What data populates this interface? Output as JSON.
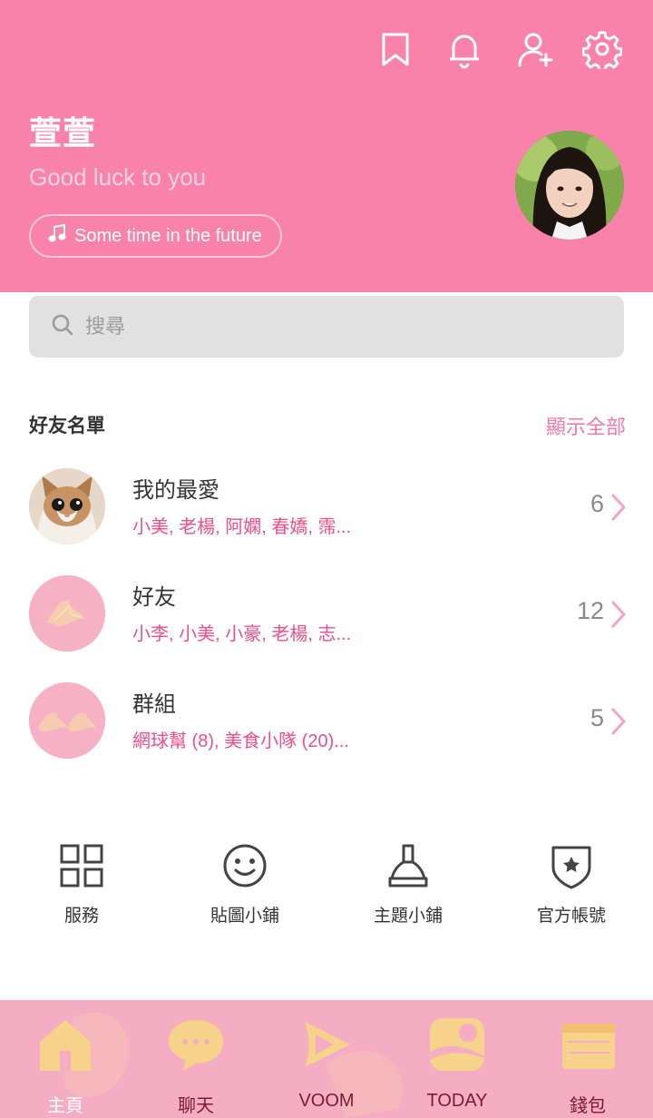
{
  "header": {
    "name": "萱萱",
    "status_message": "Good luck to you",
    "music": "Some time in the future",
    "icons": [
      "bookmark-icon",
      "bell-icon",
      "add-friend-icon",
      "gear-icon"
    ],
    "bg_color": "#f882aa"
  },
  "search": {
    "placeholder": "搜尋"
  },
  "friends": {
    "title": "好友名單",
    "show_all": "顯示全部",
    "rows": [
      {
        "title": "我的最愛",
        "members": "小美, 老楊, 阿嫻, 春嬌, 霈...",
        "count": "6"
      },
      {
        "title": "好友",
        "members": "小李, 小美, 小豪, 老楊, 志...",
        "count": "12"
      },
      {
        "title": "群組",
        "members": "網球幫 (8), 美食小隊 (20)...",
        "count": "5"
      }
    ]
  },
  "services": [
    {
      "label": "服務",
      "icon": "grid-icon"
    },
    {
      "label": "貼圖小鋪",
      "icon": "smiley-icon"
    },
    {
      "label": "主題小鋪",
      "icon": "brush-icon"
    },
    {
      "label": "官方帳號",
      "icon": "shield-star-icon"
    }
  ],
  "tabbar": {
    "tabs": [
      {
        "label": "主頁",
        "icon": "home-icon",
        "active": true
      },
      {
        "label": "聊天",
        "icon": "chat-icon",
        "active": false
      },
      {
        "label": "VOOM",
        "icon": "voom-icon",
        "active": false
      },
      {
        "label": "TODAY",
        "icon": "today-icon",
        "active": false
      },
      {
        "label": "錢包",
        "icon": "wallet-icon",
        "active": false
      }
    ]
  }
}
